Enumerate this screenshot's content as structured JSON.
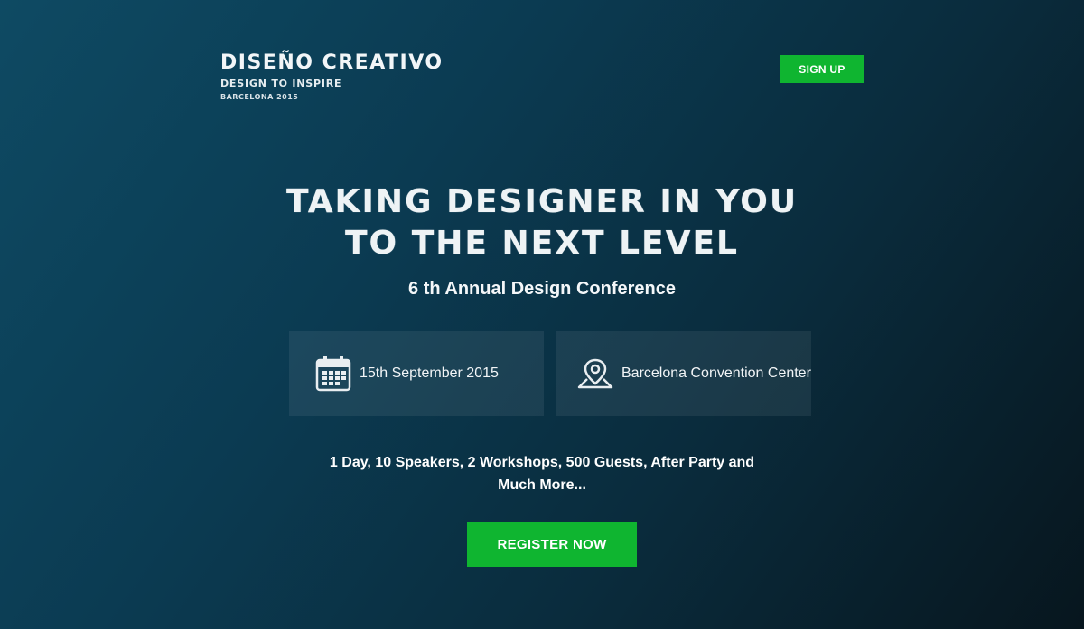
{
  "brand": {
    "title": "DISEÑO CREATIVO",
    "tagline": "DESIGN TO INSPIRE",
    "event": "BARCELONA 2015"
  },
  "header": {
    "signup_label": "SIGN UP"
  },
  "hero": {
    "headline_line1": "TAKING DESIGNER IN YOU",
    "headline_line2": "TO THE NEXT LEVEL",
    "subheadline": "6 th Annual Design Conference"
  },
  "info": {
    "date": {
      "icon": "calendar-icon",
      "text": "15th September 2015"
    },
    "venue": {
      "icon": "map-pin-icon",
      "text": "Barcelona Convention Center"
    }
  },
  "highlights": {
    "line1": "1 Day, 10 Speakers, 2 Workshops, 500 Guests, After Party and",
    "line2": "Much More..."
  },
  "cta": {
    "register_label": "REGISTER NOW"
  },
  "colors": {
    "accent": "#0fb530",
    "background_start": "#0e4a63",
    "background_end": "#07161e"
  }
}
